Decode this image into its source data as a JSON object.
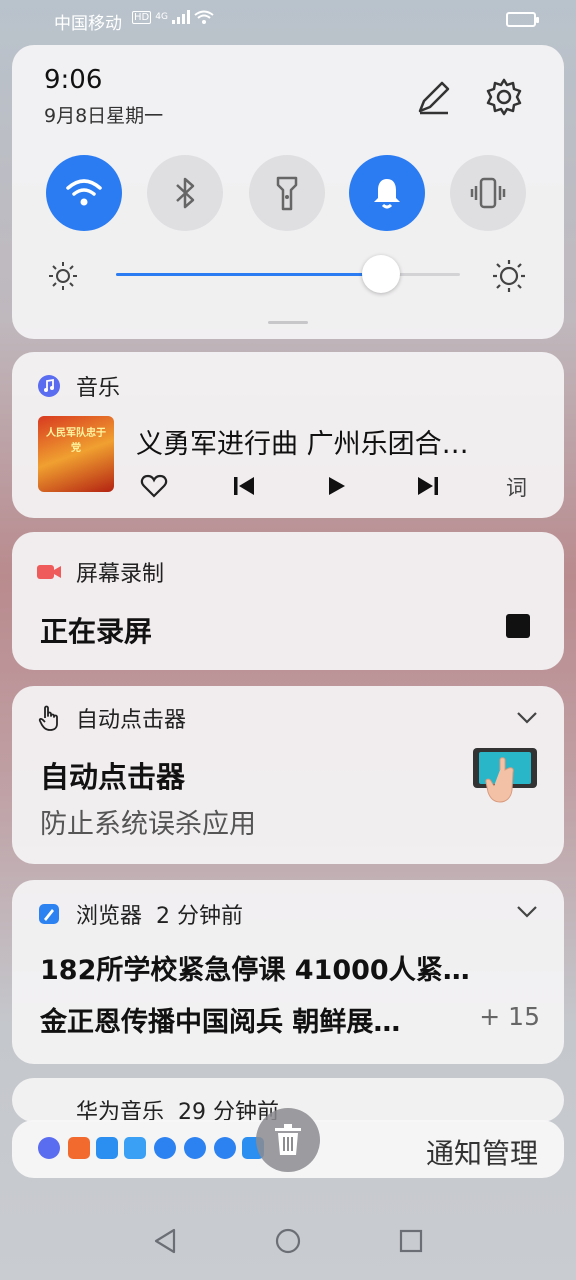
{
  "status_bar": {
    "carrier": "中国移动",
    "hd": "HD",
    "network": "4G"
  },
  "quick_settings": {
    "time": "9:06",
    "date": "9月8日星期一",
    "toggles": [
      {
        "name": "wifi",
        "on": true
      },
      {
        "name": "bluetooth",
        "on": false
      },
      {
        "name": "flashlight",
        "on": false
      },
      {
        "name": "sound",
        "on": true
      },
      {
        "name": "vibrate",
        "on": false
      }
    ],
    "brightness": 0.77,
    "accent": "#2b7cf3"
  },
  "music": {
    "app": "音乐",
    "title": "义勇军进行曲 广州乐团合…",
    "lyric_label": "词",
    "cover_text": "人民军队忠于党"
  },
  "recording": {
    "app": "屏幕录制",
    "title": "正在录屏"
  },
  "clicker": {
    "app": "自动点击器",
    "title": "自动点击器",
    "subtitle": "防止系统误杀应用"
  },
  "browser": {
    "app": "浏览器",
    "time": "2 分钟前",
    "line1": "182所学校紧急停课 41000人紧…",
    "line2": "金正恩传播中国阅兵 朝鲜展…",
    "more": "+ 15"
  },
  "huawei_music": {
    "app": "华为音乐",
    "time": "29 分钟前"
  },
  "bottom": {
    "manage_label": "通知管理"
  }
}
